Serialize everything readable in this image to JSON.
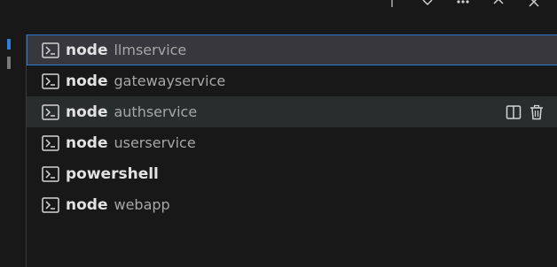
{
  "toolbar": {
    "icons": [
      "divider-icon",
      "chevron-down-icon",
      "more-icon",
      "maximize-icon",
      "close-icon"
    ]
  },
  "terminals": [
    {
      "name": "node",
      "description": "llmservice",
      "state": "selected"
    },
    {
      "name": "node",
      "description": "gatewayservice",
      "state": "normal"
    },
    {
      "name": "node",
      "description": "authservice",
      "state": "hovered"
    },
    {
      "name": "node",
      "description": "userservice",
      "state": "normal"
    },
    {
      "name": "powershell",
      "description": "",
      "state": "normal"
    },
    {
      "name": "node",
      "description": "webapp",
      "state": "normal"
    }
  ],
  "row_actions": [
    "split-terminal-icon",
    "trash-icon"
  ],
  "colors": {
    "background": "#181818",
    "selected_row": "#37373d",
    "hovered_row": "#2a2d2e",
    "focus_border": "#2b79d0",
    "accent": "#2f7ed8",
    "text": "#e2e2e2",
    "muted_text": "#a7a7a7"
  }
}
